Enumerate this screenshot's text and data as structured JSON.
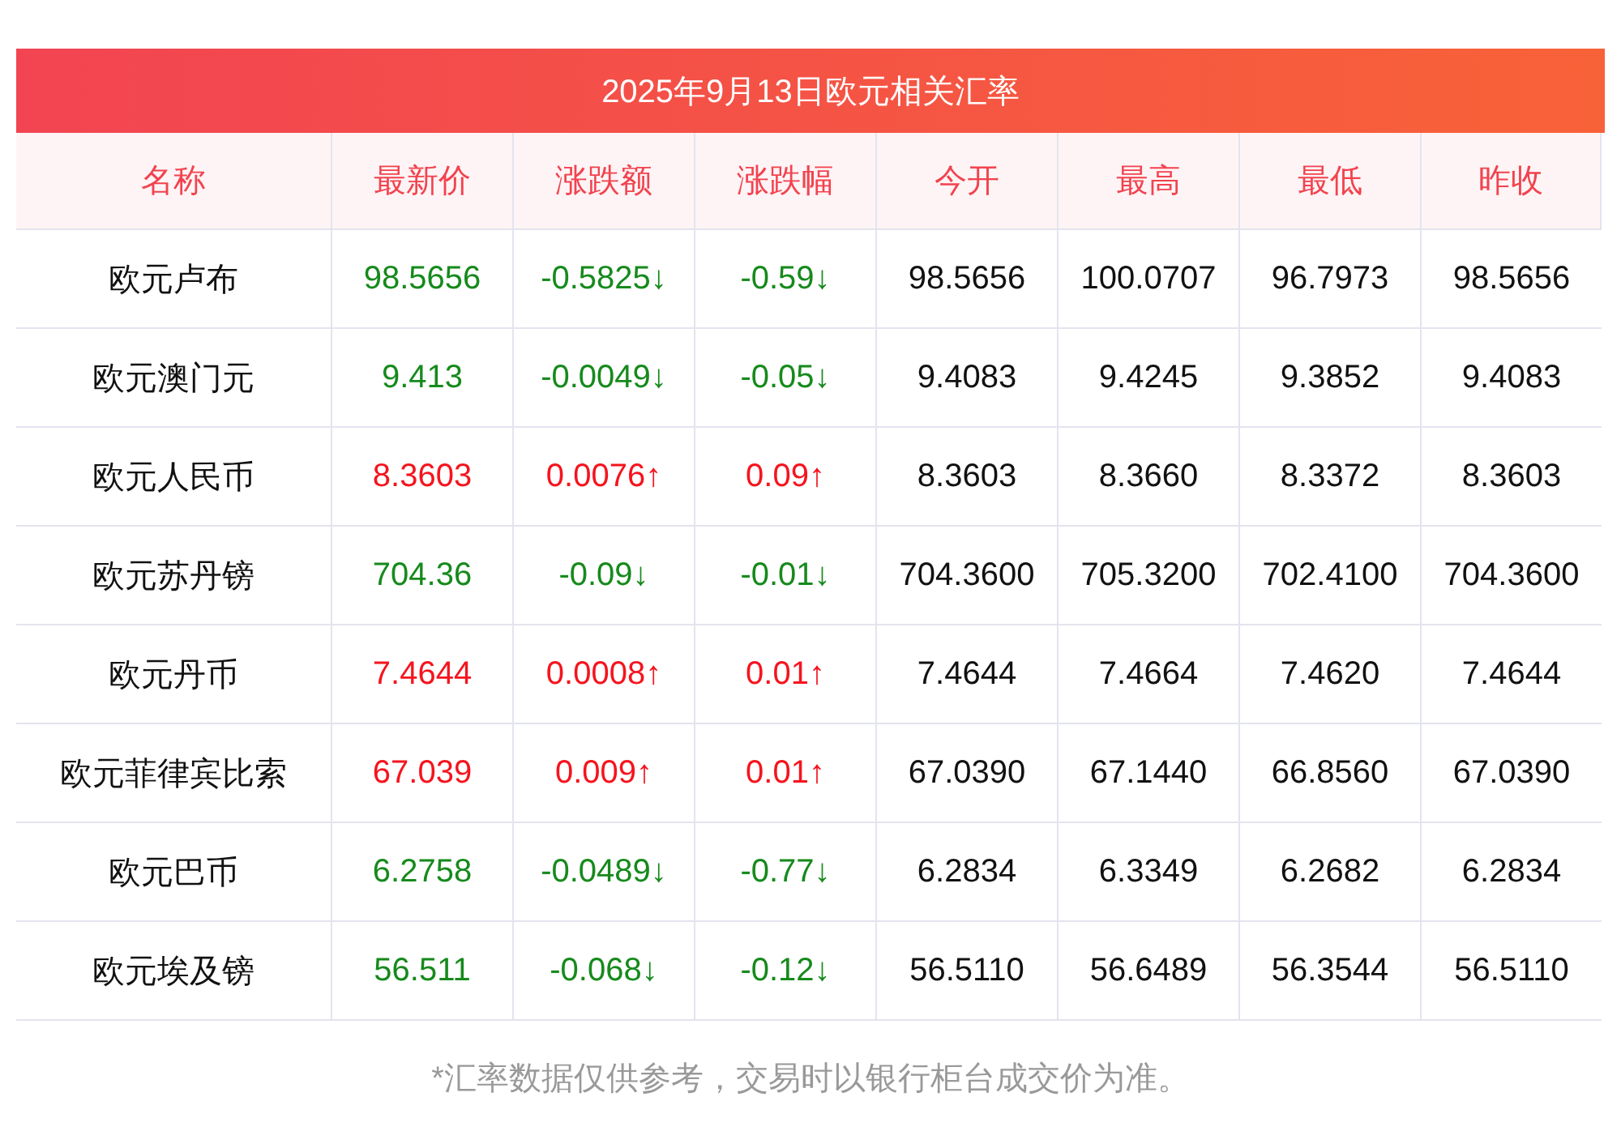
{
  "title": "2025年9月13日欧元相关汇率",
  "columns": [
    "名称",
    "最新价",
    "涨跌额",
    "涨跌幅",
    "今开",
    "最高",
    "最低",
    "昨收"
  ],
  "rows": [
    {
      "rising": false,
      "cells": [
        "欧元卢布",
        "98.5656",
        "-0.5825↓",
        "-0.59↓",
        "98.5656",
        "100.0707",
        "96.7973",
        "98.5656"
      ]
    },
    {
      "rising": false,
      "cells": [
        "欧元澳门元",
        "9.413",
        "-0.0049↓",
        "-0.05↓",
        "9.4083",
        "9.4245",
        "9.3852",
        "9.4083"
      ]
    },
    {
      "rising": true,
      "cells": [
        "欧元人民币",
        "8.3603",
        "0.0076↑",
        "0.09↑",
        "8.3603",
        "8.3660",
        "8.3372",
        "8.3603"
      ]
    },
    {
      "rising": false,
      "cells": [
        "欧元苏丹镑",
        "704.36",
        "-0.09↓",
        "-0.01↓",
        "704.3600",
        "705.3200",
        "702.4100",
        "704.3600"
      ]
    },
    {
      "rising": true,
      "cells": [
        "欧元丹币",
        "7.4644",
        "0.0008↑",
        "0.01↑",
        "7.4644",
        "7.4664",
        "7.4620",
        "7.4644"
      ]
    },
    {
      "rising": true,
      "cells": [
        "欧元菲律宾比索",
        "67.039",
        "0.009↑",
        "0.01↑",
        "67.0390",
        "67.1440",
        "66.8560",
        "67.0390"
      ]
    },
    {
      "rising": false,
      "cells": [
        "欧元巴币",
        "6.2758",
        "-0.0489↓",
        "-0.77↓",
        "6.2834",
        "6.3349",
        "6.2682",
        "6.2834"
      ]
    },
    {
      "rising": false,
      "cells": [
        "欧元埃及镑",
        "56.511",
        "-0.068↓",
        "-0.12↓",
        "56.5110",
        "56.6489",
        "56.3544",
        "56.5110"
      ]
    }
  ],
  "footnote": "*汇率数据仅供参考，交易时以银行柜台成交价为准。"
}
